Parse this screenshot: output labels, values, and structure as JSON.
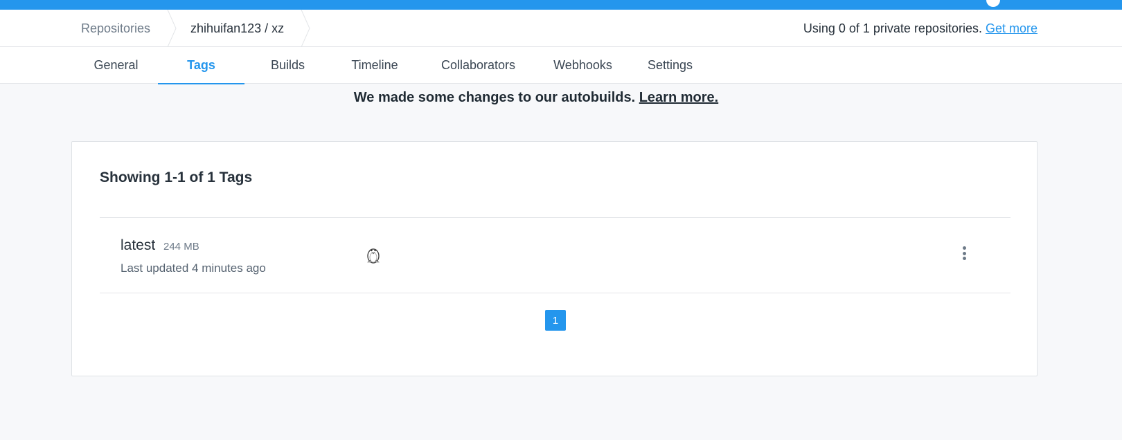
{
  "breadcrumb": {
    "root": "Repositories",
    "repo": "zhihuifan123 / xz"
  },
  "usage": {
    "text": "Using 0 of 1 private repositories.",
    "link": "Get more"
  },
  "tabs": [
    {
      "label": "General"
    },
    {
      "label": "Tags"
    },
    {
      "label": "Builds"
    },
    {
      "label": "Timeline"
    },
    {
      "label": "Collaborators"
    },
    {
      "label": "Webhooks"
    },
    {
      "label": "Settings"
    }
  ],
  "active_tab": "Tags",
  "banner": {
    "text": "We made some changes to our autobuilds.",
    "link": "Learn more."
  },
  "tags_panel": {
    "title": "Showing 1-1 of 1 Tags",
    "items": [
      {
        "name": "latest",
        "size": "244 MB",
        "updated": "Last updated 4 minutes ago",
        "os_icon": "linux-tux-icon"
      }
    ]
  },
  "pagination": {
    "current_page": "1"
  },
  "colors": {
    "accent": "#2496ed",
    "topbar": "#2496ed",
    "background": "#f7f8fa"
  }
}
